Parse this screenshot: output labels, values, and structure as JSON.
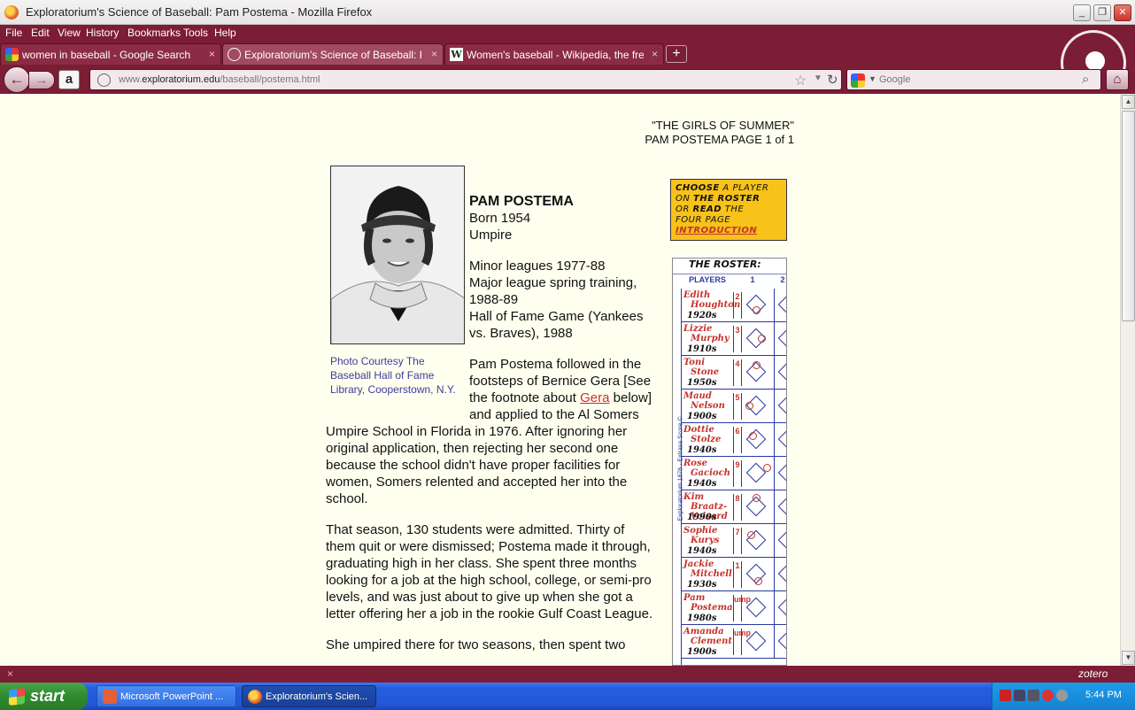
{
  "window": {
    "title": "Exploratorium's Science of Baseball: Pam Postema - Mozilla Firefox",
    "min": "_",
    "max": "❐",
    "close": "✕"
  },
  "menu": [
    "File",
    "Edit",
    "View",
    "History",
    "Bookmarks",
    "Tools",
    "Help"
  ],
  "tabs": [
    {
      "label": "women in baseball - Google Search",
      "close": "×"
    },
    {
      "label": "Exploratorium's Science of Baseball: Pam ...",
      "close": "×"
    },
    {
      "label": "Women's baseball - Wikipedia, the free e...",
      "close": "×"
    }
  ],
  "new_tab": "+",
  "nav": {
    "back": "←",
    "forward": "→",
    "amazon": "a",
    "url_prefix": "www.",
    "url_domain": "exploratorium.edu",
    "url_path": "/baseball/postema.html",
    "search_placeholder": "Google"
  },
  "page": {
    "header_line1": "\"THE GIRLS OF SUMMER\"",
    "header_line2": "PAM POSTEMA PAGE 1 of 1",
    "caption": "Photo Courtesy The Baseball Hall of Fame Library, Cooperstown, N.Y.",
    "name": "PAM POSTEMA",
    "born": "Born 1954",
    "role": "Umpire",
    "career_1": "Minor leagues 1977-88",
    "career_2": "Major league spring training, 1988-89",
    "career_3": "Hall of Fame Game (Yankees vs. Braves), 1988",
    "para1_a": "Pam Postema followed in the footsteps of Bernice Gera [See the footnote about ",
    "para1_link": "Gera",
    "para1_b": " below] and applied to the Al Somers Umpire School in Florida in 1976. After ignoring her original application, then rejecting her second one because the school didn't have proper facilities for women, Somers relented and accepted her into the school.",
    "para2": "That season, 130 students were admitted. Thirty of them quit or were dismissed; Postema made it through, graduating high in her class. She spent three months looking for a job at the high school, college, or semi-pro levels, and was just about to give up when she got a letter offering her a job in the rookie Gulf Coast League.",
    "para3": "She umpired there for two seasons, then spent two"
  },
  "choose": {
    "w1": "CHOOSE",
    "w2": " A PLAYER",
    "w3": "ON ",
    "w4": "THE ROSTER",
    "w5": "OR ",
    "w6": "READ",
    "w7": " THE",
    "w8": "FOUR PAGE",
    "intro": "INTRODUCTION"
  },
  "roster": {
    "title": "THE ROSTER:",
    "col_players": "PLAYERS",
    "col_1": "1",
    "col_2": "2",
    "side_text": "Exploratorium 1876 · Extrasa Score ©",
    "players": [
      {
        "first": "Edith",
        "last": "Houghton",
        "era": "1920s",
        "pos": "2"
      },
      {
        "first": "Lizzie",
        "last": "Murphy",
        "era": "1910s",
        "pos": "3"
      },
      {
        "first": "Toni",
        "last": "Stone",
        "era": "1950s",
        "pos": "4"
      },
      {
        "first": "Maud",
        "last": "Nelson",
        "era": "1900s",
        "pos": "5"
      },
      {
        "first": "Dottie",
        "last": "Stolze",
        "era": "1940s",
        "pos": "6"
      },
      {
        "first": "Rose",
        "last": "Gacioch",
        "era": "1940s",
        "pos": "9"
      },
      {
        "first": "Kim",
        "last": "Braatz-Voisard",
        "era": "1990s",
        "pos": "8"
      },
      {
        "first": "Sophie",
        "last": "Kurys",
        "era": "1940s",
        "pos": "7"
      },
      {
        "first": "Jackie",
        "last": "Mitchell",
        "era": "1930s",
        "pos": "1"
      },
      {
        "first": "Pam",
        "last": "Postema",
        "era": "1980s",
        "pos": "ump"
      },
      {
        "first": "Amanda",
        "last": "Clement",
        "era": "1900s",
        "pos": "ump"
      }
    ]
  },
  "statusbar": {
    "close": "×",
    "zotero": "zotero"
  },
  "taskbar": {
    "start": "start",
    "tasks": [
      "Microsoft PowerPoint ...",
      "Exploratorium's Scien..."
    ],
    "clock": "5:44 PM"
  }
}
